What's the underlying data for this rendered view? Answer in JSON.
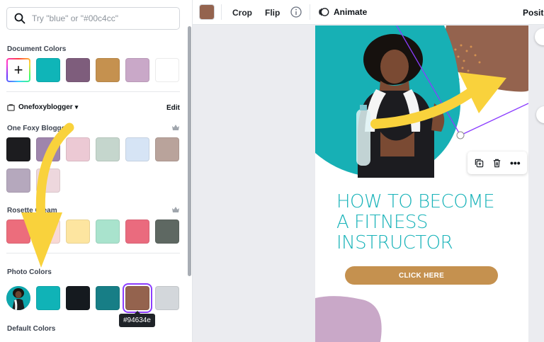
{
  "search": {
    "placeholder": "Try \"blue\" or \"#00c4cc\""
  },
  "sections": {
    "document_colors": "Document Colors",
    "brand_kit": "Onefoxyblogger",
    "edit": "Edit",
    "palette1": "One Foxy Blogger",
    "palette2": "Rosette Cream",
    "photo_colors": "Photo Colors",
    "default_colors": "Default Colors"
  },
  "document_colors": [
    "#0fb5b8",
    "#7e5d7c",
    "#c5914f",
    "#c9a8c8",
    "#ffffff"
  ],
  "palette1_colors": [
    "#1c1c1f",
    "#9f85ac",
    "#ecc9d4",
    "#c5d6cd",
    "#d6e4f5",
    "#b9a39b",
    "#b5a8bd",
    "#edd7dd"
  ],
  "palette2_colors": [
    "#ec6d7c",
    "#f8d9d5",
    "#fde5a0",
    "#a9e3cd",
    "#ea6b7e",
    "#5e6862"
  ],
  "photo_colors": [
    "#10b3b7",
    "#151a1f",
    "#177e86",
    "#94634e",
    "#d3d7db"
  ],
  "tooltip": "#94634e",
  "toolbar": {
    "current_color": "#94634e",
    "crop": "Crop",
    "flip": "Flip",
    "animate": "Animate",
    "position": "Positi"
  },
  "design": {
    "title_lines": [
      "HOW TO BECOME",
      "A FITNESS",
      "INSTRUCTOR"
    ],
    "cta": "CLICK HERE",
    "teal": "#17b0b5",
    "brown": "#94634e",
    "mauve": "#c9a8c8"
  },
  "icons": {
    "search": "search-icon",
    "add": "add-color-icon",
    "crown": "crown-icon",
    "info": "info-icon",
    "animate": "animate-icon",
    "copy": "duplicate-icon",
    "trash": "trash-icon",
    "more": "more-icon"
  }
}
